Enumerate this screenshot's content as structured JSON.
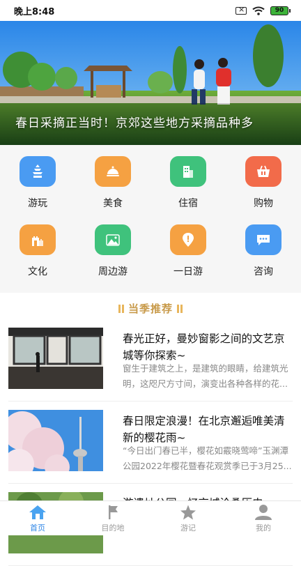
{
  "status_bar": {
    "time": "晚上8:48",
    "battery": "90"
  },
  "banner": {
    "caption": "春日采摘正当时！京郊这些地方采摘品种多",
    "slide_count": 5,
    "active_slide": 4
  },
  "categories": [
    {
      "label": "游玩",
      "icon": "pagoda-icon",
      "color": "#4a9bf2"
    },
    {
      "label": "美食",
      "icon": "food-cloche-icon",
      "color": "#f5a142"
    },
    {
      "label": "住宿",
      "icon": "building-icon",
      "color": "#3fc27c"
    },
    {
      "label": "购物",
      "icon": "shopping-basket-icon",
      "color": "#f26b4a"
    },
    {
      "label": "文化",
      "icon": "great-wall-icon",
      "color": "#f5a142"
    },
    {
      "label": "周边游",
      "icon": "mountain-icon",
      "color": "#3fc27c"
    },
    {
      "label": "一日游",
      "icon": "map-pin-icon",
      "color": "#f5a142"
    },
    {
      "label": "咨询",
      "icon": "chat-bubble-icon",
      "color": "#4a9bf2"
    }
  ],
  "section": {
    "title": "当季推荐"
  },
  "articles": [
    {
      "title": "春光正好，曼妙窗影之间的文艺京城等你探索~",
      "summary": "窗生于建筑之上，是建筑的眼睛，给建筑光明，这咫尺方寸间，演变出各种各样的花..."
    },
    {
      "title": "春日限定浪漫！在北京邂逅唯美清新的樱花雨~",
      "summary": "“今日出门春已半，樱花如霰晓莺啼”玉渊潭公园2022年樱花暨春花观赏季已于3月25..."
    },
    {
      "title": "游遗址公园，忆京城沧桑历史",
      "summary": ""
    }
  ],
  "tabbar": {
    "tabs": [
      {
        "label": "首页",
        "icon": "home-icon",
        "active": true
      },
      {
        "label": "目的地",
        "icon": "flag-icon",
        "active": false
      },
      {
        "label": "游记",
        "icon": "star-icon",
        "active": false
      },
      {
        "label": "我的",
        "icon": "user-icon",
        "active": false
      }
    ]
  },
  "colors": {
    "accent": "#2f86e6",
    "section_gold": "#c89a4a"
  }
}
